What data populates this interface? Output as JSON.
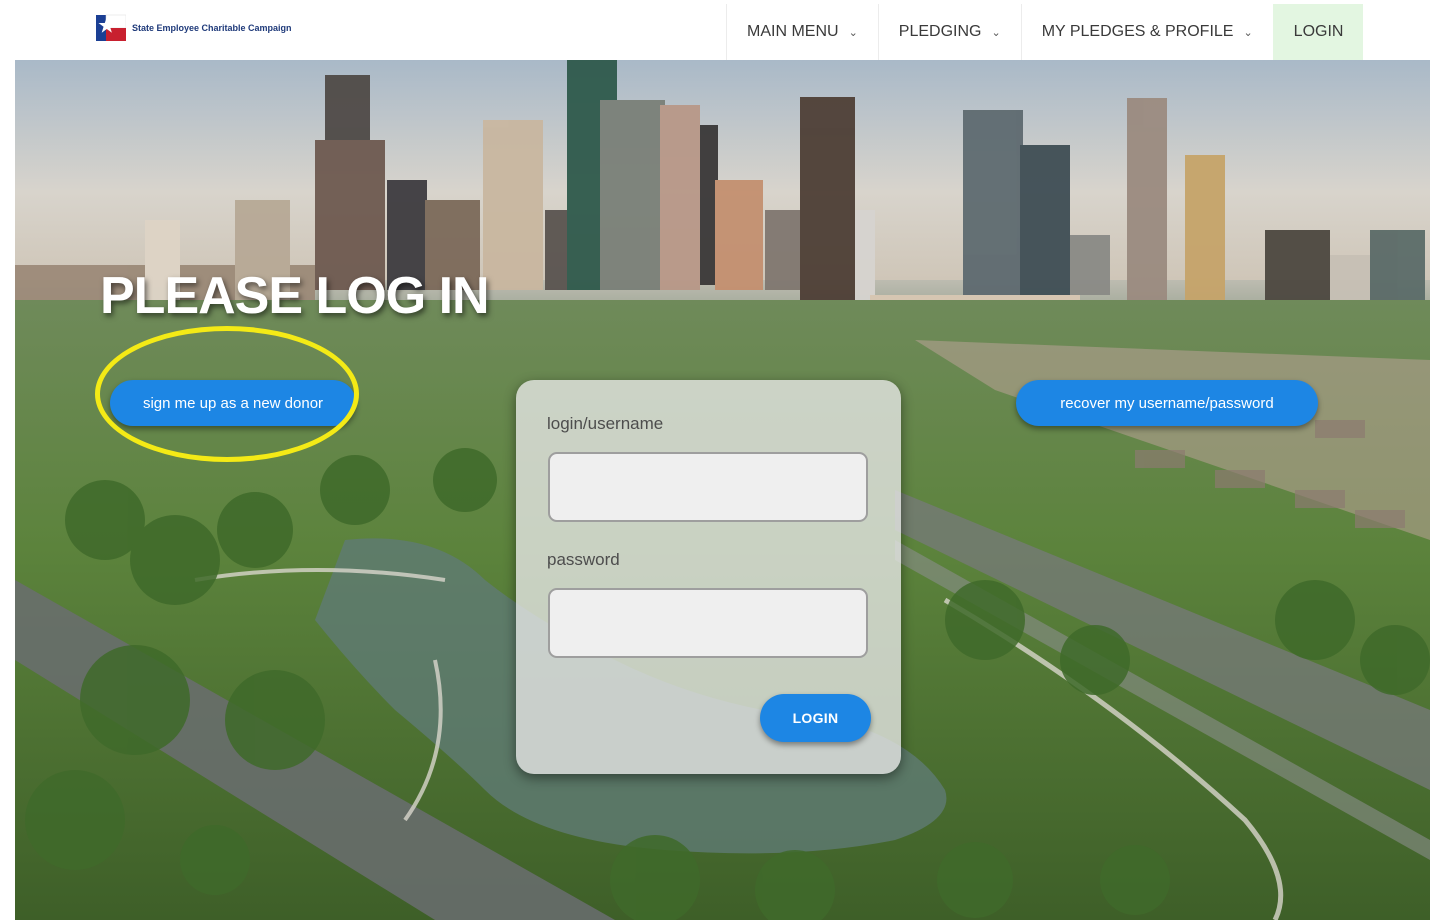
{
  "header": {
    "logo_text": "State Employee Charitable Campaign",
    "nav": [
      {
        "label": "MAIN MENU",
        "has_dropdown": true
      },
      {
        "label": "PLEDGING",
        "has_dropdown": true
      },
      {
        "label": "MY PLEDGES & PROFILE",
        "has_dropdown": true
      },
      {
        "label": "LOGIN",
        "has_dropdown": false,
        "active": true
      }
    ],
    "chevron": "⌄"
  },
  "hero": {
    "title": "PLEASE LOG IN",
    "signup_label": "sign me up as a new donor",
    "recover_label": "recover my username/password",
    "background": "city-skyline-park-photo"
  },
  "login_form": {
    "username_label": "login/username",
    "username_value": "",
    "password_label": "password",
    "password_value": "",
    "submit_label": "LOGIN"
  },
  "colors": {
    "primary_button": "#1d86e4",
    "active_nav": "#e3f6e1",
    "highlight_ring": "#f4ea16"
  }
}
